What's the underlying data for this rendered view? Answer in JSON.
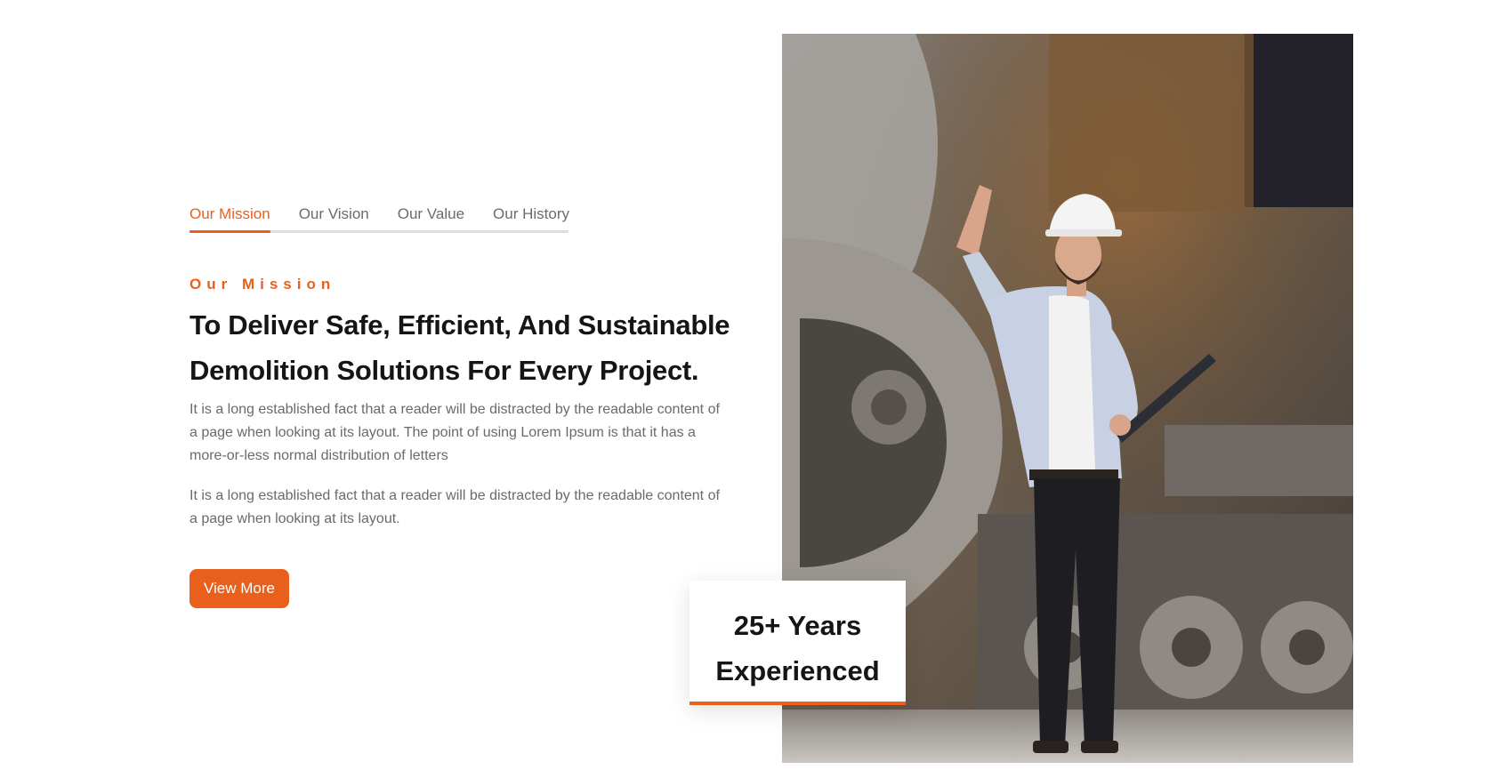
{
  "tabs": [
    {
      "label": "Our Mission",
      "active": true
    },
    {
      "label": "Our Vision",
      "active": false
    },
    {
      "label": "Our Value",
      "active": false
    },
    {
      "label": "Our History",
      "active": false
    }
  ],
  "section": {
    "eyebrow": "Our Mission",
    "heading": "To Deliver Safe, Efficient, And Sustainable Demolition Solutions For Every Project.",
    "paragraphs": [
      "It is a long established fact that a reader will be distracted by the readable content of a page when looking at its layout. The point of using Lorem Ipsum is that it has a more-or-less normal distribution of letters",
      "It is a long established fact that a reader will be distracted by the readable content of a page when looking at its layout."
    ],
    "button_label": "View More"
  },
  "experience": {
    "line1": "25+ Years",
    "line2": "Experienced"
  },
  "colors": {
    "accent": "#e8601c",
    "heading": "#151515",
    "body_text": "#6a6a6a"
  },
  "image": {
    "subject": "engineer in white hard hat and white shirt raising a hand, holding a tablet, standing in front of rusted demolition machinery"
  }
}
